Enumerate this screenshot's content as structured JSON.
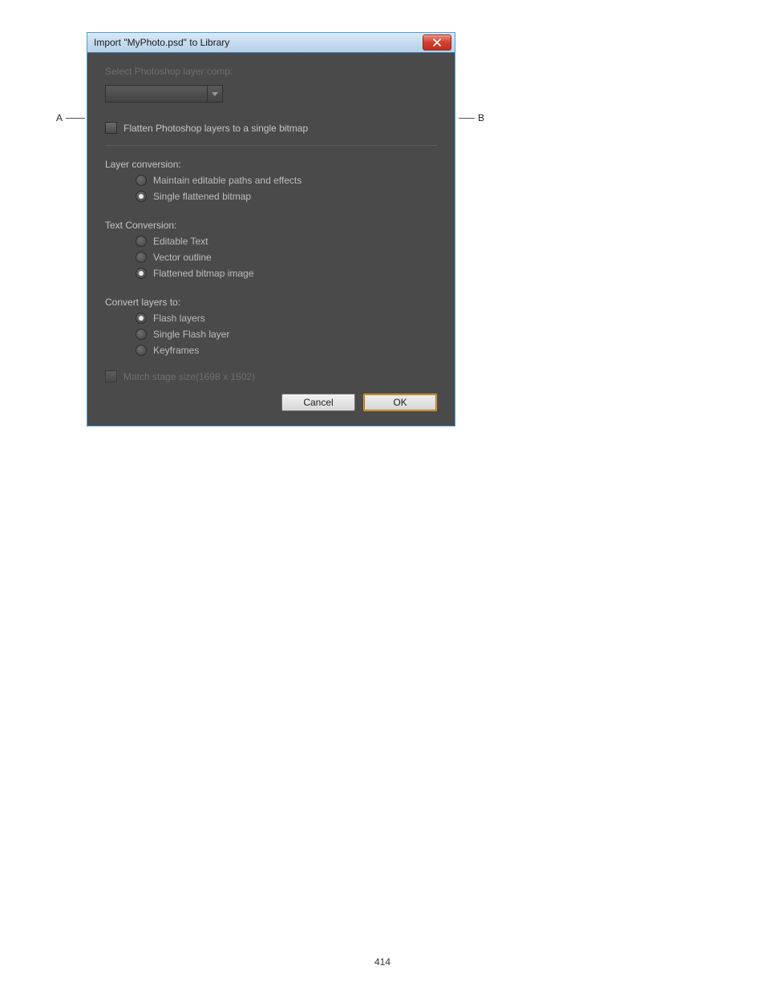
{
  "page_number": "414",
  "callouts": {
    "a": "A",
    "b": "B"
  },
  "dialog": {
    "title": "Import \"MyPhoto.psd\" to Library",
    "top": {
      "select_layer_comp_label": "Select Photoshop layer comp:",
      "combo_value": "",
      "flatten_label": "Flatten Photoshop layers to a single bitmap",
      "flatten_checked": false
    },
    "layer_conversion": {
      "label": "Layer conversion:",
      "options": [
        {
          "label": "Maintain editable paths and effects",
          "selected": false
        },
        {
          "label": "Single flattened bitmap",
          "selected": true
        }
      ]
    },
    "text_conversion": {
      "label": "Text Conversion:",
      "options": [
        {
          "label": "Editable Text",
          "selected": false
        },
        {
          "label": "Vector outline",
          "selected": false
        },
        {
          "label": "Flattened bitmap image",
          "selected": true
        }
      ]
    },
    "convert_layers": {
      "label": "Convert layers to:",
      "options": [
        {
          "label": "Flash layers",
          "selected": true
        },
        {
          "label": "Single Flash layer",
          "selected": false
        },
        {
          "label": "Keyframes",
          "selected": false
        }
      ]
    },
    "match_stage": {
      "label": "Match stage size(1698 x 1502)",
      "checked": false,
      "enabled": false
    },
    "buttons": {
      "cancel": "Cancel",
      "ok": "OK"
    }
  }
}
